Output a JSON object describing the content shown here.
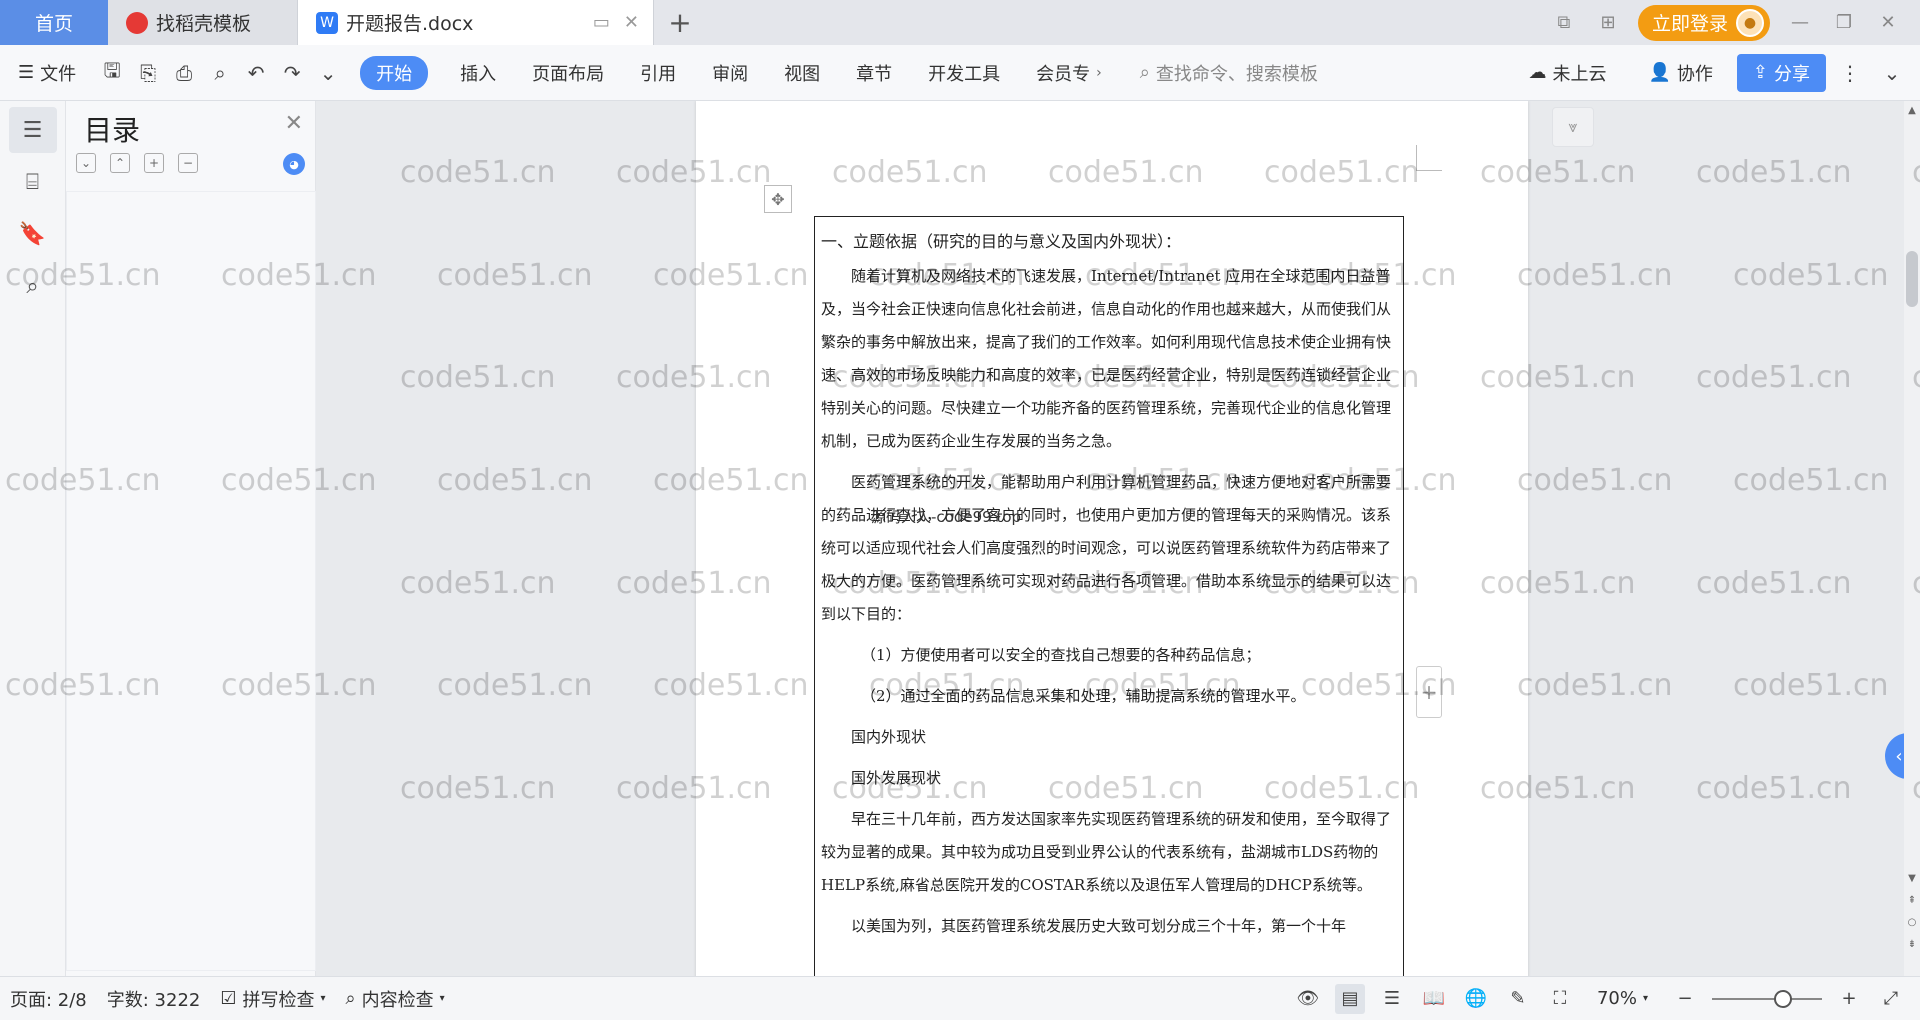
{
  "tabs": {
    "home": "首页",
    "template": "找稻壳模板",
    "document": "开题报告.docx",
    "add": "+"
  },
  "account": {
    "login": "立即登录"
  },
  "toolbar": {
    "file": "文件",
    "start": "开始",
    "insert": "插入",
    "layout": "页面布局",
    "reference": "引用",
    "review": "审阅",
    "view": "视图",
    "chapter": "章节",
    "devtools": "开发工具",
    "member": "会员专",
    "search_placeholder": "查找命令、搜索模板",
    "cloud": "未上云",
    "collab": "协作",
    "share": "分享"
  },
  "toc": {
    "title": "目录"
  },
  "document": {
    "heading": "一、立题依据（研究的目的与意义及国内外现状）：",
    "p1": "随着计算机及网络技术的飞速发展，Internet/Intranet 应用在全球范围内日益普及，当今社会正快速向信息化社会前进，信息自动化的作用也越来越大，从而使我们从繁杂的事务中解放出来，提高了我们的工作效率。如何利用现代信息技术使企业拥有快速、高效的市场反映能力和高度的效率，已是医药经营企业，特别是医药连锁经营企业特别关心的问题。尽快建立一个功能齐备的医药管理系统，完善现代企业的信息化管理机制，已成为医药企业生存发展的当务之急。",
    "p2": "医药管理系统的开发，能帮助用户利用计算机管理药品，快速方便地对客户所需要的药品进行查找，方便了客户的同时，也使用户更加方便的管理每天的采购情况。该系统可以适应现代社会人们高度强烈的时间观念，可以说医药管理系统软件为药店带来了极大的方便。医药管理系统可实现对药品进行各项管理。借助本系统显示的结果可以达到以下目的：",
    "item1": "（1）方便使用者可以安全的查找自己想要的各种药品信息；",
    "item2": "（2）通过全面的药品信息采集和处理，辅助提高系统的管理水平。",
    "sub1": "国内外现状",
    "sub2": "国外发展现状",
    "p3": "早在三十几年前，西方发达国家率先实现医药管理系统的研发和使用，至今取得了较为显著的成果。其中较为成功且受到业界公认的代表系统有，盐湖城市LDS药物的HELP系统,麻省总医院开发的COSTAR系统以及退伍军人管理局的DHCP系统等。",
    "p4": "以美国为列，其医药管理系统发展历史大致可划分成三个十年，第一个十年",
    "overlay": "源码人人-code99.top"
  },
  "watermark": "code51.cn",
  "status": {
    "page": "页面: 2/8",
    "words": "字数: 3222",
    "spell": "拼写检查",
    "content": "内容检查",
    "zoom": "70%"
  }
}
